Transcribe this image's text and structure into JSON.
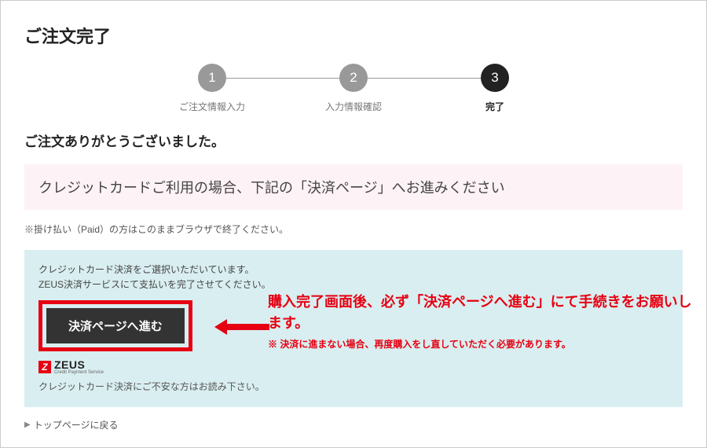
{
  "page_title": "ご注文完了",
  "stepper": {
    "steps": [
      {
        "num": "1",
        "label": "ご注文情報入力",
        "active": false
      },
      {
        "num": "2",
        "label": "入力情報確認",
        "active": false
      },
      {
        "num": "3",
        "label": "完了",
        "active": true
      }
    ]
  },
  "thanks_message": "ご注文ありがとうございました。",
  "notice_box": "クレジットカードご利用の場合、下記の「決済ページ」へお進みください",
  "sub_note": "※掛け払い（Paid）の方はこのままブラウザで終了ください。",
  "payment_panel": {
    "line1": "クレジットカード決済をご選択いただいています。",
    "line2": "ZEUS決済サービスにて支払いを完了させてください。",
    "button_label": "決済ページへ進む",
    "zeus_logo_mark": "Z",
    "zeus_logo_name": "ZEUS",
    "zeus_logo_sub": "Credit Payment Service",
    "zeus_note": "クレジットカード決済にご不安な方はお読み下さい。"
  },
  "callout": {
    "main": "購入完了画面後、必ず「決済ページへ進む」にて手続きをお願いします。",
    "sub": "※ 決済に進まない場合、再度購入をし直していただく必要があります。"
  },
  "back_link": "トップページに戻る"
}
